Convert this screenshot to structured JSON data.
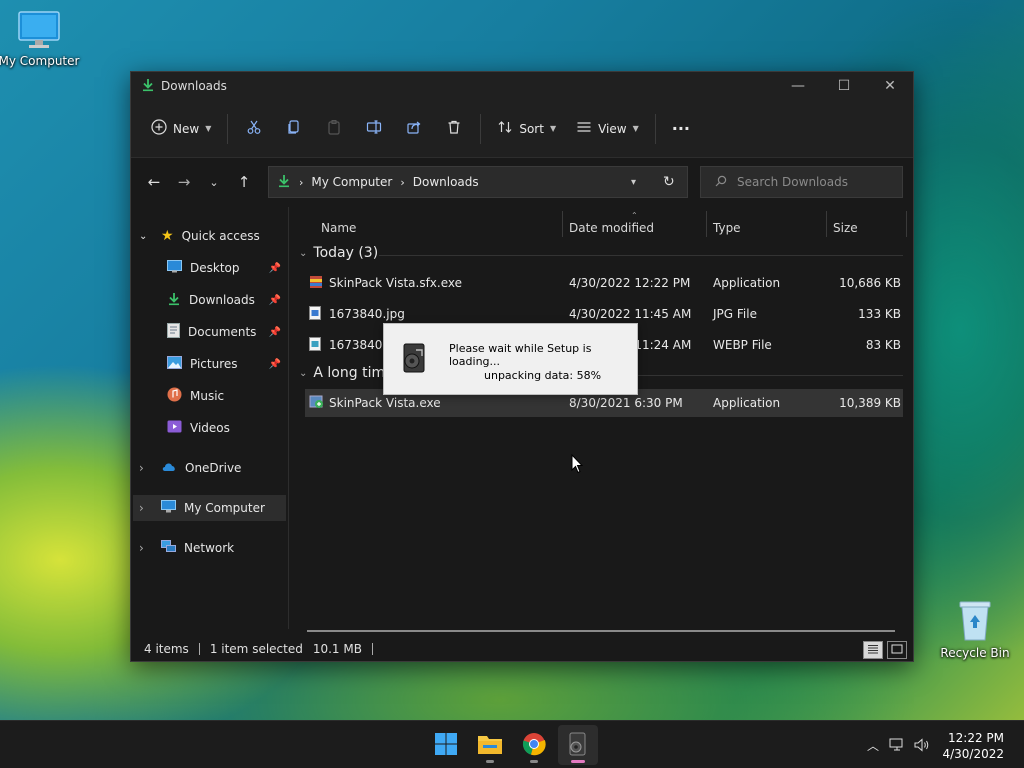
{
  "desktop": {
    "my_computer_label": "My Computer",
    "recycle_bin_label": "Recycle Bin"
  },
  "window": {
    "title": "Downloads",
    "toolbar": {
      "new_label": "New",
      "sort_label": "Sort",
      "view_label": "View",
      "more_label": "···"
    },
    "address": {
      "segments": [
        "My Computer",
        "Downloads"
      ],
      "search_placeholder": "Search Downloads"
    },
    "sidebar": {
      "quick_access": "Quick access",
      "items": [
        {
          "label": "Desktop"
        },
        {
          "label": "Downloads"
        },
        {
          "label": "Documents"
        },
        {
          "label": "Pictures"
        },
        {
          "label": "Music"
        },
        {
          "label": "Videos"
        }
      ],
      "onedrive": "OneDrive",
      "my_computer": "My Computer",
      "network": "Network"
    },
    "columns": {
      "name": "Name",
      "date": "Date modified",
      "type": "Type",
      "size": "Size"
    },
    "groups": {
      "today": "Today (3)",
      "long_time": "A long time ago"
    },
    "files_today": [
      {
        "name": "SkinPack Vista.sfx.exe",
        "date": "4/30/2022 12:22 PM",
        "type": "Application",
        "size": "10,686 KB"
      },
      {
        "name": "1673840.jpg",
        "date": "4/30/2022 11:45 AM",
        "type": "JPG File",
        "size": "133 KB"
      },
      {
        "name": "1673840.webp",
        "date": "4/30/2022 11:24 AM",
        "type": "WEBP File",
        "size": "83 KB"
      }
    ],
    "files_old": [
      {
        "name": "SkinPack Vista.exe",
        "date": "8/30/2021 6:30 PM",
        "type": "Application",
        "size": "10,389 KB"
      }
    ],
    "status": {
      "items": "4 items",
      "selected": "1 item selected",
      "size": "10.1 MB"
    }
  },
  "dialog": {
    "message": "Please wait while Setup is loading...",
    "progress_text": "unpacking data: 58%"
  },
  "taskbar": {
    "time": "12:22 PM",
    "date": "4/30/2022"
  }
}
